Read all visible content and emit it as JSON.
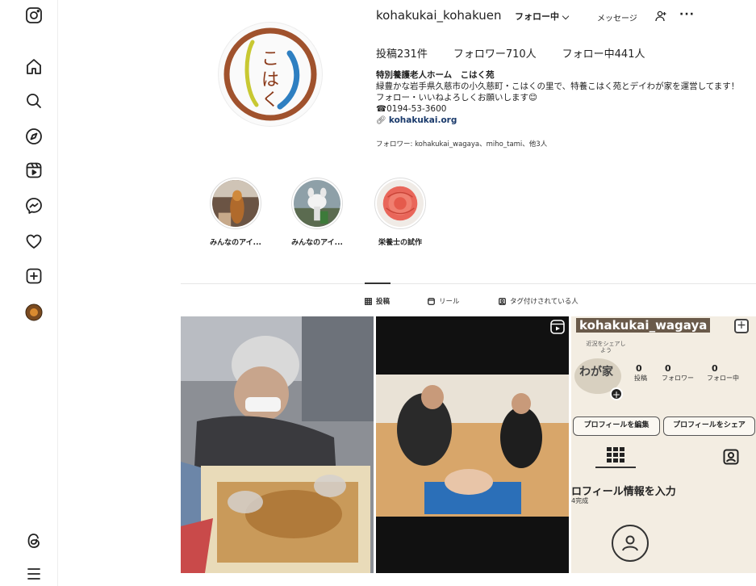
{
  "profile": {
    "username": "kohakukai_kohakuen",
    "follow_button": "フォロー中",
    "message_button": "メッセージ",
    "posts_stat": "投稿231件",
    "followers_stat": "フォロワー710人",
    "following_stat": "フォロー中441人",
    "bio_name": "特別養護老人ホーム　こはく苑",
    "bio_line1": "緑豊かな岩手県久慈市の小久慈町・こはくの里で、特養こはく苑とデイわが家を運営してます！",
    "bio_line2": "フォロー・いいねよろしくお願いします😊",
    "bio_phone": "☎0194-53-3600",
    "bio_link": "kohakukai.org",
    "followed_by": "フォロワー: kohakukai_wagaya、miho_tami、他3人",
    "avatar_text": "こはく"
  },
  "highlights": [
    {
      "label": "みんなのアイ..."
    },
    {
      "label": "みんなのアイ..."
    },
    {
      "label": "栄養士の試作"
    }
  ],
  "tabs": [
    {
      "label": "投稿",
      "active": true
    },
    {
      "label": "リール",
      "active": false
    },
    {
      "label": "タグ付けされている人",
      "active": false
    }
  ],
  "embedded_screenshot": {
    "username": "kohakukai_wagaya",
    "share_hint": "近況をシェアしよう",
    "avatar_text": "わが家",
    "stats": [
      {
        "num": "0",
        "label": "投稿"
      },
      {
        "num": "0",
        "label": "フォロワー"
      },
      {
        "num": "0",
        "label": "フォロー中"
      }
    ],
    "edit_button": "プロフィールを編集",
    "share_button": "プロフィールをシェア",
    "heading": "ロフィール情報を入力",
    "progress": "4完成"
  },
  "icons": {
    "sidebar": [
      "instagram-icon",
      "home-icon",
      "search-icon",
      "explore-icon",
      "reels-icon",
      "messenger-icon",
      "notifications-icon",
      "create-icon",
      "profile-icon",
      "threads-icon",
      "menu-icon"
    ]
  },
  "colors": {
    "accent_dark": "#1a3a6b",
    "avatar_brown": "#a0522d",
    "avatar_blue": "#2e7fc1"
  }
}
